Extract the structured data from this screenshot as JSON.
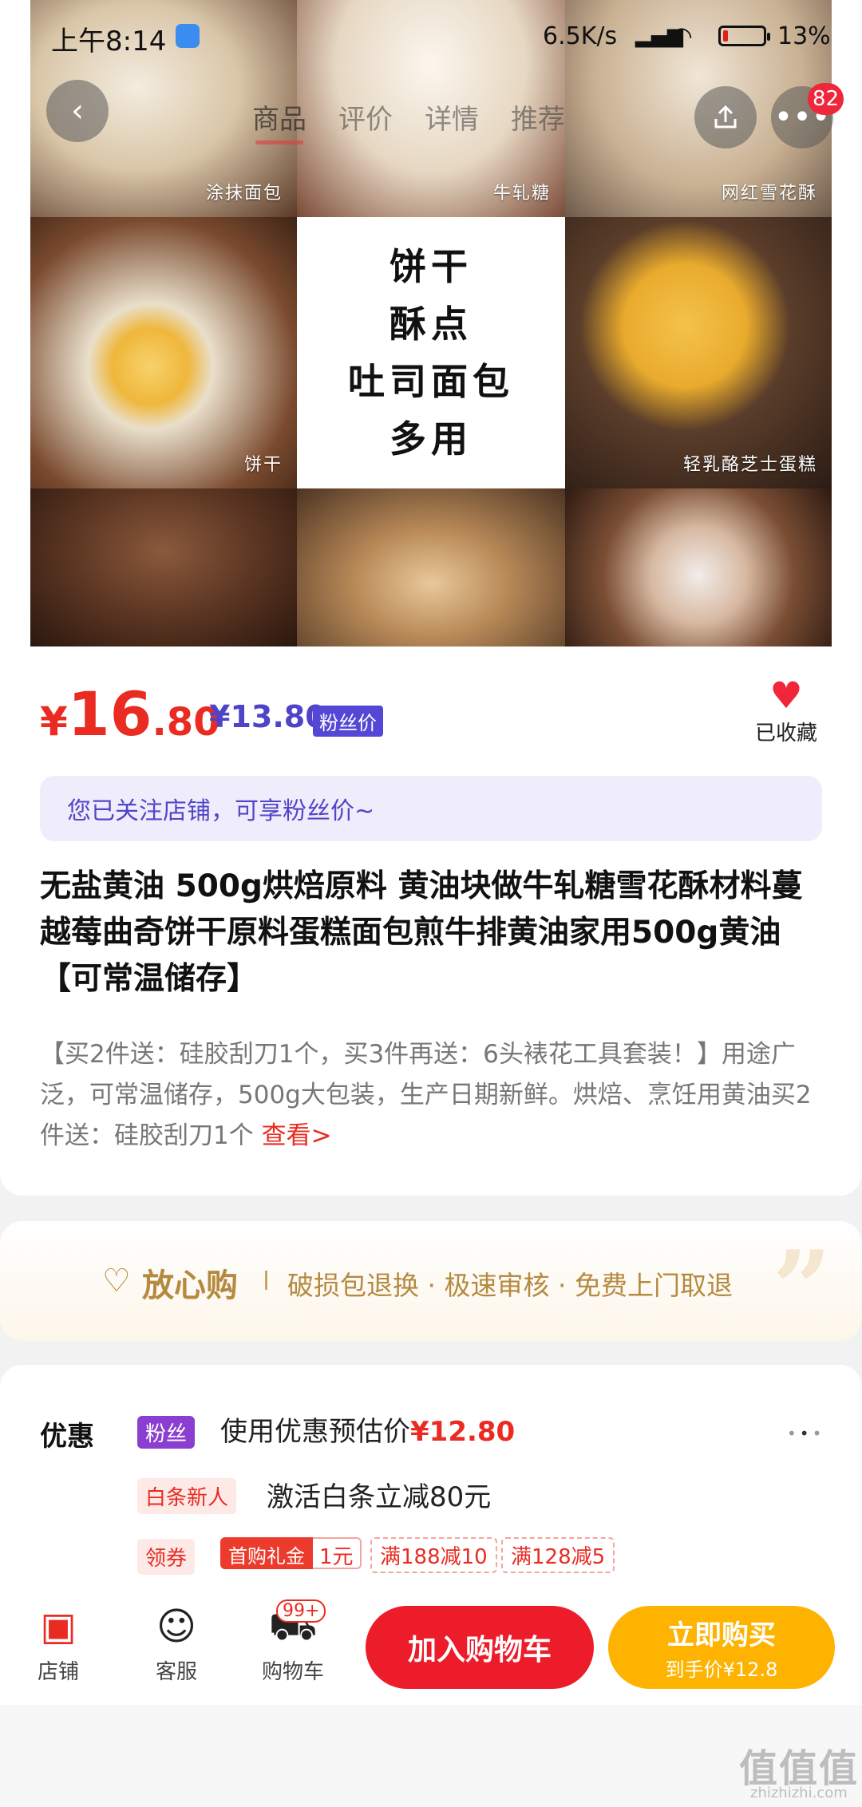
{
  "status_bar": {
    "time": "上午8:14",
    "net_speed": "6.5K/s",
    "signal": "HD",
    "battery_text": "13%",
    "battery_level": 0.13
  },
  "nav": {
    "tabs": [
      "商品",
      "评价",
      "详情",
      "推荐"
    ],
    "active_tab": 0,
    "message_count": "82"
  },
  "hero": {
    "captions": {
      "c1": "涂抹面包",
      "c2": "牛轧糖",
      "c3": "网红雪花酥",
      "c4": "饼干",
      "c6": "轻乳酪芝士蛋糕"
    },
    "center_lines": [
      "饼干",
      "酥点",
      "吐司面包",
      "多用"
    ]
  },
  "price": {
    "currency": "¥",
    "integer": "16",
    "decimal": ".80",
    "fan_price": "¥13.80",
    "fan_badge": "粉丝价",
    "favorite_label": "已收藏",
    "accent_color": "#e92b22"
  },
  "notice": "您已关注店铺，可享粉丝价~",
  "product_title": "无盐黄油 500g烘焙原料 黄油块做牛轧糖雪花酥材料蔓越莓曲奇饼干原料蛋糕面包煎牛排黄油家用500g黄油【可常温储存】",
  "description": {
    "text": "【买2件送：硅胶刮刀1个，买3件再送：6头裱花工具套装！】用途广泛，可常温储存，500g大包装，生产日期新鲜。烘焙、烹饪用黄油买2件送：硅胶刮刀1个 ",
    "more": "查看>"
  },
  "guarantee": {
    "title": "放心购",
    "items": "破损包退换 · 极速审核 · 免费上门取退"
  },
  "promo": {
    "label": "优惠",
    "fan_tag": "粉丝",
    "estimate_prefix": "使用优惠预估价",
    "estimate_value": "¥12.80",
    "baitiao_tag": "白条新人",
    "baitiao_text": "激活白条立减80元",
    "coupon_tag": "领券",
    "first_gift_label": "首购礼金",
    "first_gift_value": "1元",
    "coupons": [
      "满188减10",
      "满128减5"
    ]
  },
  "actions": {
    "shop": "店铺",
    "service": "客服",
    "cart": "购物车",
    "cart_badge": "99+",
    "add_cart": "加入购物车",
    "buy_now": "立即购买",
    "buy_now_sub": "到手价¥12.8"
  },
  "watermark": {
    "main": "值值值",
    "sub": "zhizhizhi.com"
  },
  "icons": {
    "back": "back-arrow-icon",
    "share": "share-icon",
    "more": "more-dots-icon",
    "heart": "heart-icon",
    "shop": "shop-icon",
    "service": "chat-icon",
    "cart": "cart-icon"
  }
}
